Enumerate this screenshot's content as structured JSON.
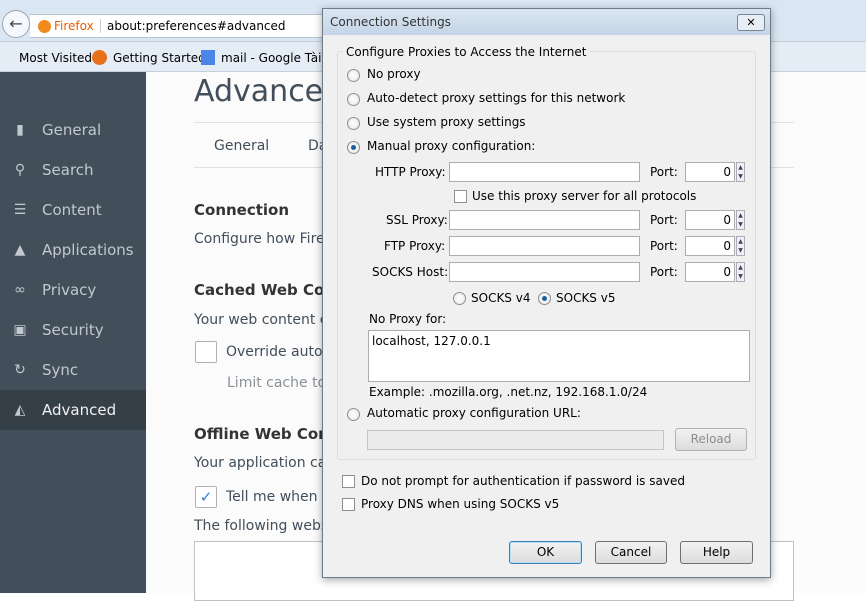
{
  "browser": {
    "identity_label": "Firefox",
    "url": "about:preferences#advanced",
    "bookmarks": [
      "Most Visited",
      "Getting Started",
      "mail - Google Tài li"
    ]
  },
  "sidebar": {
    "items": [
      {
        "label": "General",
        "icon": "general-icon",
        "glyph": "▮"
      },
      {
        "label": "Search",
        "icon": "search-icon",
        "glyph": "⚲"
      },
      {
        "label": "Content",
        "icon": "content-icon",
        "glyph": "☰"
      },
      {
        "label": "Applications",
        "icon": "rocket-icon",
        "glyph": "▲"
      },
      {
        "label": "Privacy",
        "icon": "mask-icon",
        "glyph": "∞"
      },
      {
        "label": "Security",
        "icon": "lock-icon",
        "glyph": "▣"
      },
      {
        "label": "Sync",
        "icon": "sync-icon",
        "glyph": "↻"
      },
      {
        "label": "Advanced",
        "icon": "wizard-hat-icon",
        "glyph": "◭",
        "selected": true
      }
    ]
  },
  "page": {
    "title": "Advanced",
    "tabs": [
      "General",
      "Da"
    ],
    "connection_heading": "Connection",
    "connection_text": "Configure how Firef",
    "cache_heading": "Cached Web Con",
    "cache_text": "Your web content c",
    "override_label": "Override autor",
    "limit_label": "Limit cache to",
    "offline_heading": "Offline Web Cont",
    "offline_text": "Your application ca",
    "tell_me_label": "Tell me when a",
    "following_text": "The following webs"
  },
  "dialog": {
    "title": "Connection Settings",
    "close_glyph": "✕",
    "group_label": "Configure Proxies to Access the Internet",
    "radios": [
      "No proxy",
      "Auto-detect proxy settings for this network",
      "Use system proxy settings",
      "Manual proxy configuration:"
    ],
    "selected_mode": "Manual proxy configuration:",
    "http_label": "HTTP Proxy:",
    "http_value": "",
    "http_port": "0",
    "port_label": "Port:",
    "share_label": "Use this proxy server for all protocols",
    "ssl_label": "SSL Proxy:",
    "ssl_value": "",
    "ssl_port": "0",
    "ftp_label": "FTP Proxy:",
    "ftp_value": "",
    "ftp_port": "0",
    "socks_label": "SOCKS Host:",
    "socks_value": "",
    "socks_port": "0",
    "socks_v4": "SOCKS v4",
    "socks_v5": "SOCKS v5",
    "socks_selected": "SOCKS v5",
    "no_proxy_label": "No Proxy for:",
    "no_proxy_value": "localhost, 127.0.0.1",
    "example": "Example: .mozilla.org, .net.nz, 192.168.1.0/24",
    "auto_url_label": "Automatic proxy configuration URL:",
    "auto_url_value": "",
    "reload": "Reload",
    "no_prompt_label": "Do not prompt for authentication if password is saved",
    "dns_label": "Proxy DNS when using SOCKS v5",
    "ok": "OK",
    "cancel": "Cancel",
    "help": "Help"
  }
}
